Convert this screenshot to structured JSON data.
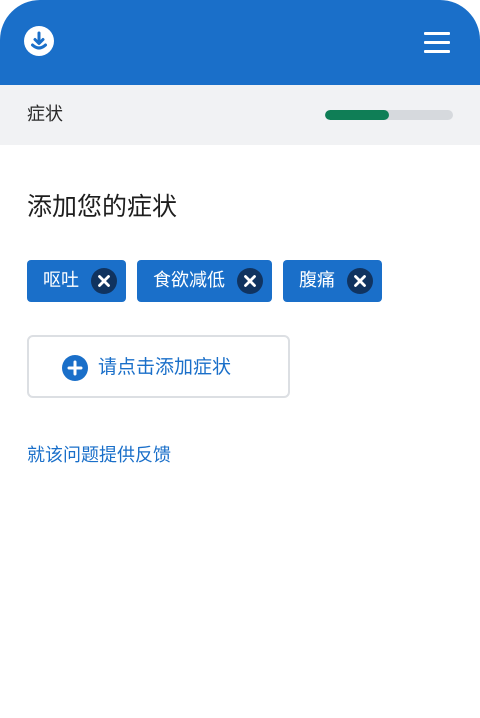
{
  "header": {
    "logo_icon": "smile-download-logo-icon",
    "menu_icon": "hamburger-menu-icon",
    "background_color": "#1a6fc9"
  },
  "progress": {
    "step_label": "症状",
    "value_fraction": 0.5,
    "fill_color": "#0f7e56",
    "track_color": "#d6d9dd"
  },
  "main": {
    "title": "添加您的症状",
    "chips": [
      {
        "label": "呕吐",
        "remove_icon": "close-icon"
      },
      {
        "label": "食欲减低",
        "remove_icon": "close-icon"
      },
      {
        "label": "腹痛",
        "remove_icon": "close-icon"
      }
    ],
    "add_button": {
      "label": "请点击添加症状",
      "icon": "plus-circle-icon"
    },
    "feedback_link": "就该问题提供反馈"
  },
  "colors": {
    "accent": "#1a6fc9",
    "chip_remove_bg": "#10335f"
  }
}
